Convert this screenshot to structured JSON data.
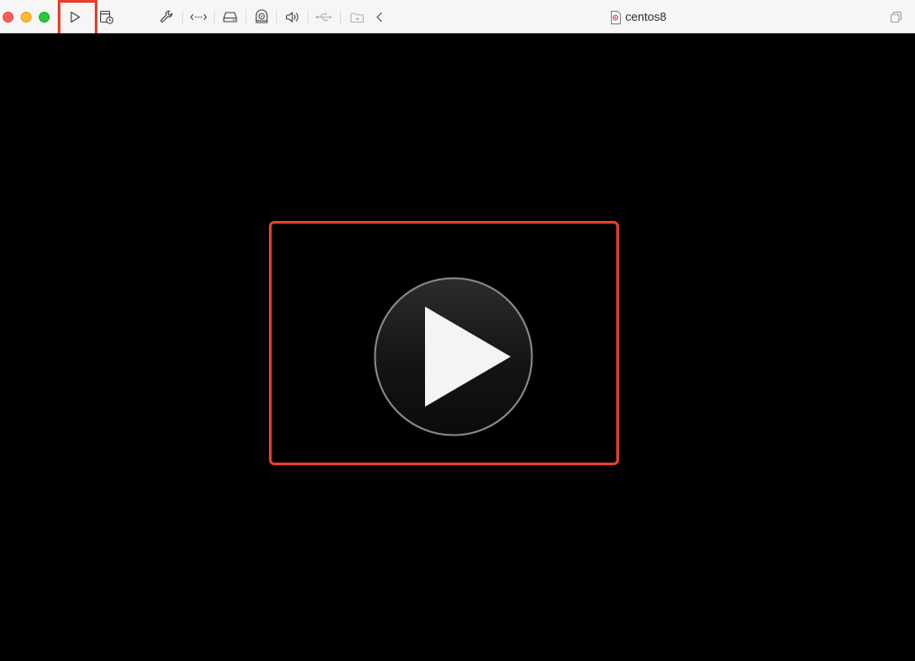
{
  "window": {
    "title": "centos8",
    "title_icon": "vm-document-icon"
  },
  "toolbar": {
    "buttons": [
      {
        "name": "start-vm-button",
        "icon": "play-icon",
        "enabled": true
      },
      {
        "name": "snapshot-button",
        "icon": "snapshot-clock-icon",
        "enabled": true
      },
      {
        "name": "settings-button",
        "icon": "wrench-icon",
        "enabled": true
      },
      {
        "name": "network-button",
        "icon": "network-arrows-icon",
        "enabled": true
      },
      {
        "name": "hard-disk-button",
        "icon": "hard-disk-icon",
        "enabled": true
      },
      {
        "name": "optical-drive-button",
        "icon": "optical-drive-icon",
        "enabled": true
      },
      {
        "name": "sound-button",
        "icon": "speaker-icon",
        "enabled": true
      },
      {
        "name": "usb-button",
        "icon": "usb-icon",
        "enabled": false
      },
      {
        "name": "shared-folders-button",
        "icon": "shared-folder-icon",
        "enabled": false
      },
      {
        "name": "collapse-toolbar-button",
        "icon": "chevron-left-icon",
        "enabled": true
      }
    ],
    "right_button": {
      "name": "window-mode-button",
      "icon": "overlap-windows-icon"
    }
  },
  "display": {
    "background": "#000000",
    "center_action": "play-icon"
  },
  "highlights": {
    "color": "#e8402a"
  }
}
